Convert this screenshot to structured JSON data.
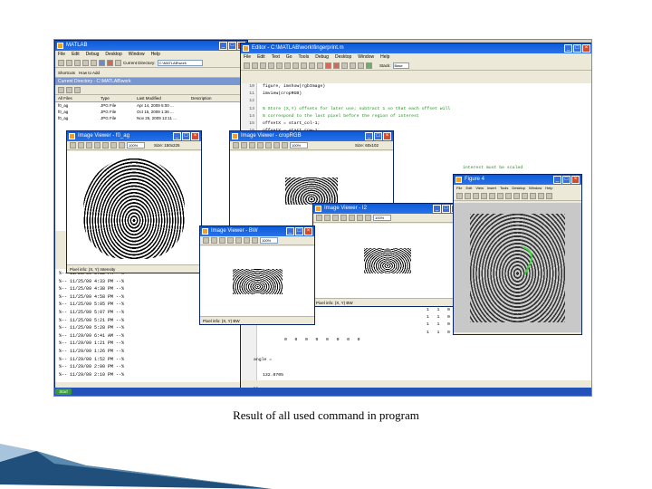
{
  "caption": "Result of all used command in program",
  "matlab": {
    "title": "MATLAB",
    "menu": [
      "File",
      "Edit",
      "Debug",
      "Desktop",
      "Window",
      "Help"
    ],
    "shortcuts": [
      "Shortcuts",
      "How to Add"
    ],
    "current_directory_label": "Current Directory:",
    "current_directory_value": "C:\\MATLAB\\work",
    "panel_title": "Current Directory - C:\\MATLAB\\work",
    "file_headers": [
      "All Files",
      "Type",
      "Last Modified",
      "Description"
    ],
    "files": [
      [
        "f0_ag",
        "JPG File",
        "Apr 14, 2009 5:00 ...",
        ""
      ],
      [
        "f0_ag",
        "JPG File",
        "Oct 15, 2009 1:36 ...",
        ""
      ],
      [
        "f0_ag",
        "JPG File",
        "Nov 25, 2009 12:11 ...",
        ""
      ]
    ],
    "history": [
      "%-- 11/25/09 3:52 PM --%",
      "%-- 11/25/09 4:33 PM --%",
      "%-- 11/25/09 4:38 PM --%",
      "%-- 11/25/09 4:58 PM --%",
      "%-- 11/25/09 5:05 PM --%",
      "%-- 11/25/09 5:07 PM --%",
      "%-- 11/25/09 5:21 PM --%",
      "%-- 11/25/09 5:28 PM --%",
      "%-- 11/29/09 6:41 AM --%",
      "%-- 11/29/09 1:21 PM --%",
      "%-- 11/29/09 1:26 PM --%",
      "%-- 11/29/09 1:52 PM --%",
      "%-- 11/29/09 2:00 PM --%",
      "%-- 11/29/09 2:10 PM --%"
    ],
    "start_label": "Start"
  },
  "editor": {
    "title": "Editor - C:\\MATLAB\\work\\fingerprint.m",
    "menu": [
      "File",
      "Edit",
      "Text",
      "Go",
      "Tools",
      "Debug",
      "Desktop",
      "Window",
      "Help"
    ],
    "stack_label": "Stack:",
    "stack_value": "Base",
    "lines": [
      {
        "n": "10",
        "t": "figure, imshow(rgbImage)",
        "c": ""
      },
      {
        "n": "11",
        "t": "imview(cropRGB)",
        "c": ""
      },
      {
        "n": "12",
        "t": "",
        "c": ""
      },
      {
        "n": "13",
        "t": "% Store (X,Y) offsets for later use; subtract 1 so that each offset will",
        "c": "cmt"
      },
      {
        "n": "14",
        "t": "% correspond to the last pixel before the region of interest",
        "c": "cmt"
      },
      {
        "n": "15",
        "t": "offsetX = start_col-1;",
        "c": ""
      },
      {
        "n": "16",
        "t": "offsetY = start_row-1;",
        "c": ""
      },
      {
        "n": "17",
        "t": "I = rgb2gray(cropRGB);",
        "c": ""
      }
    ],
    "partial_comment": "interest must be scaled",
    "matrix_rows": [
      "1   1   0   1   0",
      "1   1   0   1   0",
      "1   1   0   1   0",
      "1   1   0   1   0",
      "0   0   0   0   0   0   0   0"
    ],
    "angle_label": "angle =",
    "angle_value": "132.0705",
    "prompt": ">>"
  },
  "viewers": [
    {
      "title": "Image Viewer - f0_ag",
      "zoom": "100%",
      "size_label": "Size: 150x225",
      "status": "Pixel info: (X, Y) Intensity"
    },
    {
      "title": "Image Viewer - cropRGB",
      "zoom": "100%",
      "size_label": "Size: 60x102",
      "status": "Pixel info: (X, Y) Intensity"
    },
    {
      "title": "Image Viewer - I2",
      "zoom": "100%",
      "size_label": "",
      "status": "Pixel info: (X, Y) BW"
    },
    {
      "title": "Image Viewer - BW",
      "zoom": "100%",
      "size_label": "",
      "status": "Pixel info: (X, Y) BW"
    }
  ],
  "figure": {
    "title": "Figure 4",
    "menu": [
      "File",
      "Edit",
      "View",
      "Insert",
      "Tools",
      "Desktop",
      "Window",
      "Help"
    ]
  },
  "colors": {
    "titlebar": "#0a5ad8",
    "accent_arrow": "#1f4f7a",
    "highlight": "#3cd23c"
  }
}
